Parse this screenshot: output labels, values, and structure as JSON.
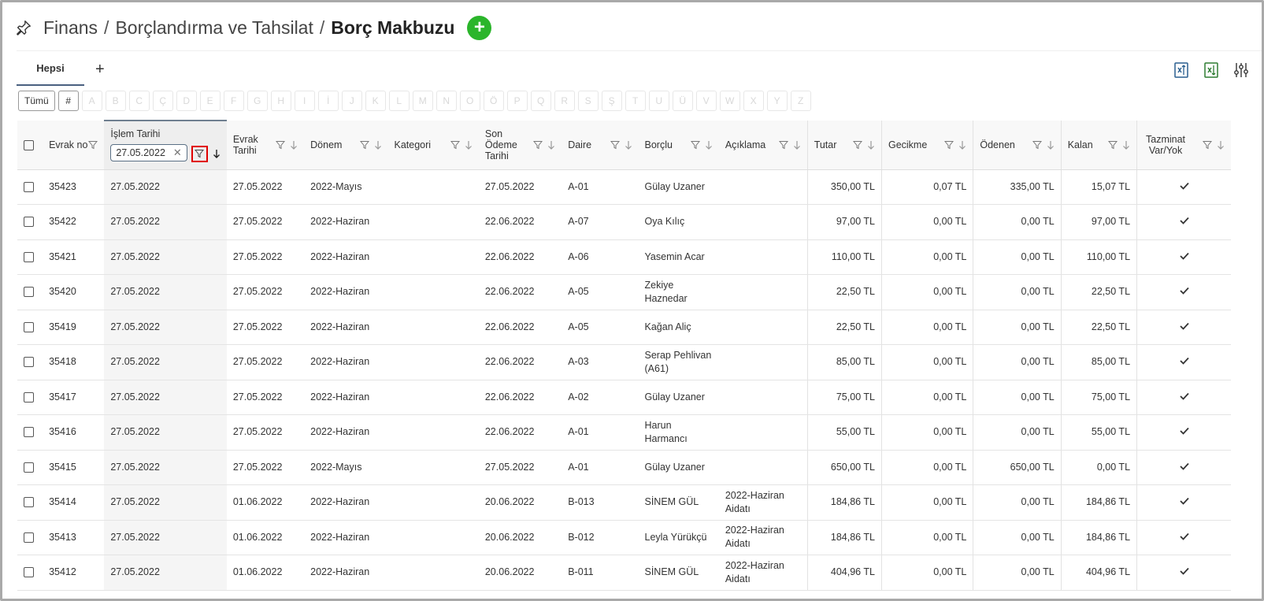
{
  "breadcrumb": {
    "parts": [
      "Finans",
      "Borçlandırma ve Tahsilat"
    ],
    "current": "Borç Makbuzu",
    "separator": "/"
  },
  "tabs": {
    "active": "Hepsi",
    "add": "+"
  },
  "alphabet": {
    "all": "Tümü",
    "hash": "#",
    "letters": [
      "A",
      "B",
      "C",
      "Ç",
      "D",
      "E",
      "F",
      "G",
      "H",
      "I",
      "İ",
      "J",
      "K",
      "L",
      "M",
      "N",
      "O",
      "Ö",
      "P",
      "Q",
      "R",
      "S",
      "Ş",
      "T",
      "U",
      "Ü",
      "V",
      "W",
      "X",
      "Y",
      "Z"
    ]
  },
  "columns": {
    "evrak_no": "Evrak no",
    "islem_tarihi": "İşlem Tarihi",
    "islem_filter_value": "27.05.2022",
    "evrak_tarihi": "Evrak Tarihi",
    "donem": "Dönem",
    "kategori": "Kategori",
    "son_odeme": "Son Ödeme Tarihi",
    "daire": "Daire",
    "borclu": "Borçlu",
    "aciklama": "Açıklama",
    "tutar": "Tutar",
    "gecikme": "Gecikme",
    "odenen": "Ödenen",
    "kalan": "Kalan",
    "tazminat": "Tazminat Var/Yok"
  },
  "rows": [
    {
      "no": "35423",
      "islem": "27.05.2022",
      "evrak": "27.05.2022",
      "donem": "2022-Mayıs",
      "kategori": "",
      "son": "27.05.2022",
      "daire": "A-01",
      "borclu": "Gülay Uzaner",
      "aciklama": "",
      "tutar": "350,00 TL",
      "gecikme": "0,07 TL",
      "odenen": "335,00 TL",
      "kalan": "15,07 TL"
    },
    {
      "no": "35422",
      "islem": "27.05.2022",
      "evrak": "27.05.2022",
      "donem": "2022-Haziran",
      "kategori": "",
      "son": "22.06.2022",
      "daire": "A-07",
      "borclu": "Oya Kılıç",
      "aciklama": "",
      "tutar": "97,00 TL",
      "gecikme": "0,00 TL",
      "odenen": "0,00 TL",
      "kalan": "97,00 TL"
    },
    {
      "no": "35421",
      "islem": "27.05.2022",
      "evrak": "27.05.2022",
      "donem": "2022-Haziran",
      "kategori": "",
      "son": "22.06.2022",
      "daire": "A-06",
      "borclu": "Yasemin Acar",
      "aciklama": "",
      "tutar": "110,00 TL",
      "gecikme": "0,00 TL",
      "odenen": "0,00 TL",
      "kalan": "110,00 TL"
    },
    {
      "no": "35420",
      "islem": "27.05.2022",
      "evrak": "27.05.2022",
      "donem": "2022-Haziran",
      "kategori": "",
      "son": "22.06.2022",
      "daire": "A-05",
      "borclu": "Zekiye Haznedar",
      "aciklama": "",
      "tutar": "22,50 TL",
      "gecikme": "0,00 TL",
      "odenen": "0,00 TL",
      "kalan": "22,50 TL"
    },
    {
      "no": "35419",
      "islem": "27.05.2022",
      "evrak": "27.05.2022",
      "donem": "2022-Haziran",
      "kategori": "",
      "son": "22.06.2022",
      "daire": "A-05",
      "borclu": "Kağan Aliç",
      "aciklama": "",
      "tutar": "22,50 TL",
      "gecikme": "0,00 TL",
      "odenen": "0,00 TL",
      "kalan": "22,50 TL"
    },
    {
      "no": "35418",
      "islem": "27.05.2022",
      "evrak": "27.05.2022",
      "donem": "2022-Haziran",
      "kategori": "",
      "son": "22.06.2022",
      "daire": "A-03",
      "borclu": "Serap Pehlivan (A61)",
      "aciklama": "",
      "tutar": "85,00 TL",
      "gecikme": "0,00 TL",
      "odenen": "0,00 TL",
      "kalan": "85,00 TL"
    },
    {
      "no": "35417",
      "islem": "27.05.2022",
      "evrak": "27.05.2022",
      "donem": "2022-Haziran",
      "kategori": "",
      "son": "22.06.2022",
      "daire": "A-02",
      "borclu": "Gülay Uzaner",
      "aciklama": "",
      "tutar": "75,00 TL",
      "gecikme": "0,00 TL",
      "odenen": "0,00 TL",
      "kalan": "75,00 TL"
    },
    {
      "no": "35416",
      "islem": "27.05.2022",
      "evrak": "27.05.2022",
      "donem": "2022-Haziran",
      "kategori": "",
      "son": "22.06.2022",
      "daire": "A-01",
      "borclu": "Harun Harmancı",
      "aciklama": "",
      "tutar": "55,00 TL",
      "gecikme": "0,00 TL",
      "odenen": "0,00 TL",
      "kalan": "55,00 TL"
    },
    {
      "no": "35415",
      "islem": "27.05.2022",
      "evrak": "27.05.2022",
      "donem": "2022-Mayıs",
      "kategori": "",
      "son": "27.05.2022",
      "daire": "A-01",
      "borclu": "Gülay Uzaner",
      "aciklama": "",
      "tutar": "650,00 TL",
      "gecikme": "0,00 TL",
      "odenen": "650,00 TL",
      "kalan": "0,00 TL"
    },
    {
      "no": "35414",
      "islem": "27.05.2022",
      "evrak": "01.06.2022",
      "donem": "2022-Haziran",
      "kategori": "",
      "son": "20.06.2022",
      "daire": "B-013",
      "borclu": "SİNEM GÜL",
      "aciklama": "2022-Haziran Aidatı",
      "tutar": "184,86 TL",
      "gecikme": "0,00 TL",
      "odenen": "0,00 TL",
      "kalan": "184,86 TL"
    },
    {
      "no": "35413",
      "islem": "27.05.2022",
      "evrak": "01.06.2022",
      "donem": "2022-Haziran",
      "kategori": "",
      "son": "20.06.2022",
      "daire": "B-012",
      "borclu": "Leyla Yürükçü",
      "aciklama": "2022-Haziran Aidatı",
      "tutar": "184,86 TL",
      "gecikme": "0,00 TL",
      "odenen": "0,00 TL",
      "kalan": "184,86 TL"
    },
    {
      "no": "35412",
      "islem": "27.05.2022",
      "evrak": "01.06.2022",
      "donem": "2022-Haziran",
      "kategori": "",
      "son": "20.06.2022",
      "daire": "B-011",
      "borclu": "SİNEM GÜL",
      "aciklama": "2022-Haziran Aidatı",
      "tutar": "404,96 TL",
      "gecikme": "0,00 TL",
      "odenen": "0,00 TL",
      "kalan": "404,96 TL"
    }
  ],
  "colors": {
    "accent_green": "#2bb52b",
    "highlight_red": "#e00000",
    "tab_underline": "#4a6080"
  }
}
